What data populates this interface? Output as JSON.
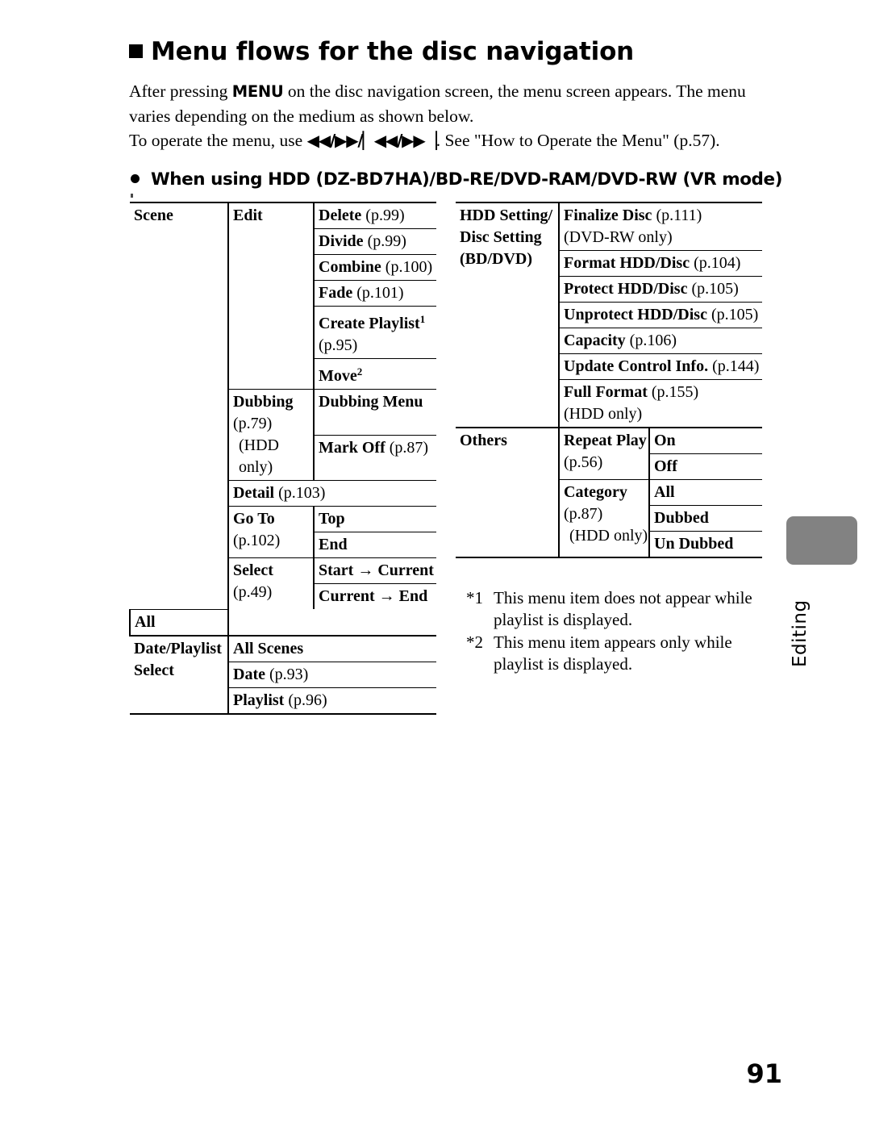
{
  "heading": {
    "marker": "■",
    "title": "Menu flows for the disc navigation"
  },
  "intro": {
    "part1": "After pressing ",
    "menu_key": "MENU",
    "part2": " on the disc navigation screen, the menu screen appears. The menu varies depending on the medium as shown below.",
    "part3": "To operate the menu, use ",
    "nav_glyphs": "◀◀/▶▶/▏◀◀/▶▶▕",
    "part4": ". See \"How to Operate the Menu\" (p.57)."
  },
  "subheading": {
    "bullet": "●",
    "text": "When using HDD (DZ-BD7HA)/BD-RE/DVD-RAM/DVD-RW (VR mode)"
  },
  "table_left": {
    "groups": [
      {
        "name": "Scene",
        "subgroups": [
          {
            "name": "Edit",
            "name_note": "",
            "items": [
              {
                "label": "Delete",
                "page": "(p.99)"
              },
              {
                "label": "Divide",
                "page": "(p.99)"
              },
              {
                "label": "Combine",
                "page": "(p.100)"
              },
              {
                "label": "Fade",
                "page": "(p.101)"
              },
              {
                "label": "Create Playlist",
                "sup": "1",
                "page2": "(p.95)"
              },
              {
                "label": "Move",
                "sup": "2"
              }
            ]
          },
          {
            "name": "Dubbing",
            "name_page": "(p.79)",
            "name_note": "(HDD only)",
            "items": [
              {
                "label": "Dubbing Menu"
              },
              {
                "label": "Mark Off",
                "page": "(p.87)"
              }
            ]
          },
          {
            "name": "Detail",
            "name_page": "(p.103)",
            "span": true,
            "items": []
          },
          {
            "name": "Go To",
            "name_page": "(p.102)",
            "items": [
              {
                "label": "Top"
              },
              {
                "label": "End"
              }
            ]
          },
          {
            "name": "Select",
            "name_page": "(p.49)",
            "inline_page": true,
            "items": [
              {
                "label": "Start → Current"
              },
              {
                "label": "Current → End"
              },
              {
                "label": "All"
              }
            ]
          }
        ]
      },
      {
        "name": "Date/Playlist Select",
        "name_line1": "Date/Playlist",
        "name_line2": "Select",
        "subgroups": [
          {
            "name": "All Scenes",
            "span": true,
            "items": []
          },
          {
            "name": "Date",
            "name_page": "(p.93)",
            "inline_page": true,
            "span": true,
            "items": []
          },
          {
            "name": "Playlist",
            "name_page": "(p.96)",
            "inline_page": true,
            "span": true,
            "items": []
          }
        ]
      }
    ]
  },
  "table_right": {
    "groups": [
      {
        "name_line1": "HDD Setting/",
        "name_line2": "Disc Setting",
        "name_line3": "(BD/DVD)",
        "subgroups": [
          {
            "name": "Finalize Disc",
            "name_page": "(p.111)",
            "inline_page": true,
            "name_note": "(DVD-RW only)",
            "span": true,
            "items": []
          },
          {
            "name": "Format HDD/Disc",
            "name_page": "(p.104)",
            "inline_page": true,
            "span": true,
            "items": []
          },
          {
            "name": "Protect HDD/Disc",
            "name_page": "(p.105)",
            "inline_page": true,
            "span": true,
            "items": []
          },
          {
            "name": "Unprotect HDD/Disc",
            "name_page": "(p.105)",
            "inline_page": true,
            "span": true,
            "items": []
          },
          {
            "name": "Capacity",
            "name_page": "(p.106)",
            "inline_page": true,
            "span": true,
            "items": []
          },
          {
            "name": "Update Control Info.",
            "name_page": "(p.144)",
            "inline_page": true,
            "span": true,
            "items": []
          },
          {
            "name": "Full Format",
            "name_page": "(p.155)",
            "inline_page": true,
            "name_note": "(HDD only)",
            "span": true,
            "items": []
          }
        ]
      },
      {
        "name_line1": "Others",
        "subgroups": [
          {
            "name": "Repeat Play",
            "name_page": "(p.56)",
            "items": [
              {
                "label": "On"
              },
              {
                "label": "Off"
              }
            ]
          },
          {
            "name": "Category",
            "name_page": "(p.87)",
            "name_note": "(HDD only)",
            "items": [
              {
                "label": "All"
              },
              {
                "label": "Dubbed"
              },
              {
                "label": "Un Dubbed"
              }
            ]
          }
        ]
      }
    ]
  },
  "footnotes": [
    {
      "mark": "*1",
      "text": "This menu item does not appear while playlist is displayed."
    },
    {
      "mark": "*2",
      "text": "This menu item appears only while playlist is displayed."
    }
  ],
  "side_tab": {
    "label": "Editing",
    "swatch_color": "#828282"
  },
  "page_number": "91"
}
